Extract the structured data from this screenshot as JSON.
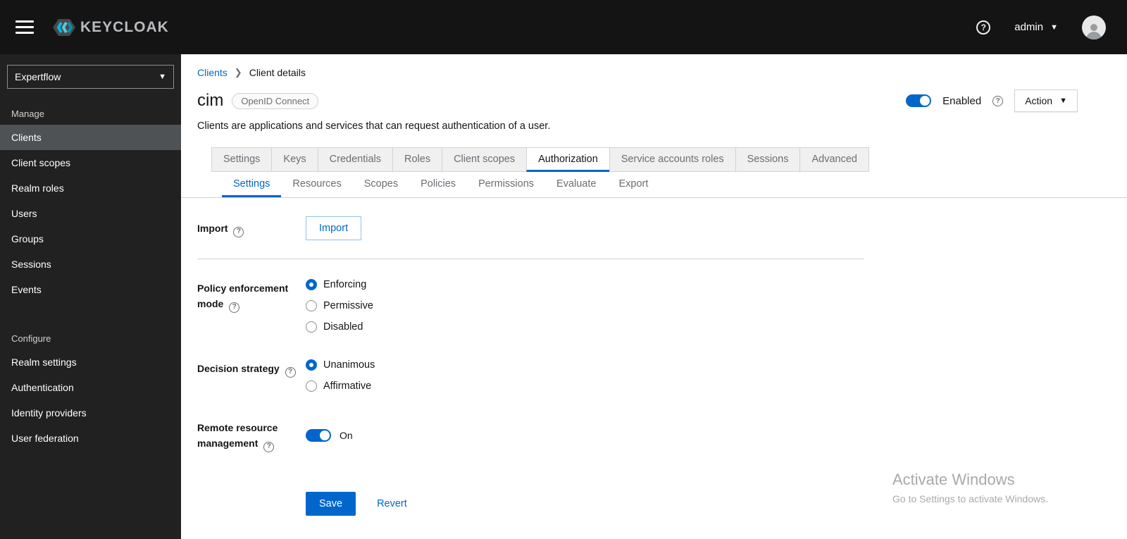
{
  "topbar": {
    "brand": "KEYCLOAK",
    "user": "admin"
  },
  "sidebar": {
    "realm": "Expertflow",
    "manage_title": "Manage",
    "manage_items": [
      "Clients",
      "Client scopes",
      "Realm roles",
      "Users",
      "Groups",
      "Sessions",
      "Events"
    ],
    "active_item": "Clients",
    "configure_title": "Configure",
    "configure_items": [
      "Realm settings",
      "Authentication",
      "Identity providers",
      "User federation"
    ]
  },
  "breadcrumb": {
    "items": [
      "Clients",
      "Client details"
    ]
  },
  "header": {
    "title": "cim",
    "badge": "OpenID Connect",
    "description": "Clients are applications and services that can request authentication of a user.",
    "enabled_label": "Enabled",
    "action_label": "Action"
  },
  "tabs": {
    "primary": [
      "Settings",
      "Keys",
      "Credentials",
      "Roles",
      "Client scopes",
      "Authorization",
      "Service accounts roles",
      "Sessions",
      "Advanced"
    ],
    "primary_active": "Authorization",
    "secondary": [
      "Settings",
      "Resources",
      "Scopes",
      "Policies",
      "Permissions",
      "Evaluate",
      "Export"
    ],
    "secondary_active": "Settings"
  },
  "form": {
    "import": {
      "label": "Import",
      "button": "Import"
    },
    "policy_enforcement": {
      "label": "Policy enforcement mode",
      "options": [
        "Enforcing",
        "Permissive",
        "Disabled"
      ],
      "selected": "Enforcing"
    },
    "decision_strategy": {
      "label": "Decision strategy",
      "options": [
        "Unanimous",
        "Affirmative"
      ],
      "selected": "Unanimous"
    },
    "remote_resource": {
      "label": "Remote resource management",
      "state": "On"
    },
    "save_label": "Save",
    "revert_label": "Revert"
  },
  "watermark": {
    "line1": "Activate Windows",
    "line2": "Go to Settings to activate Windows."
  },
  "colors": {
    "accent": "#0066cc",
    "topbar_bg": "#141414",
    "sidebar_bg": "#212121",
    "sidebar_active_bg": "#4f5255"
  }
}
